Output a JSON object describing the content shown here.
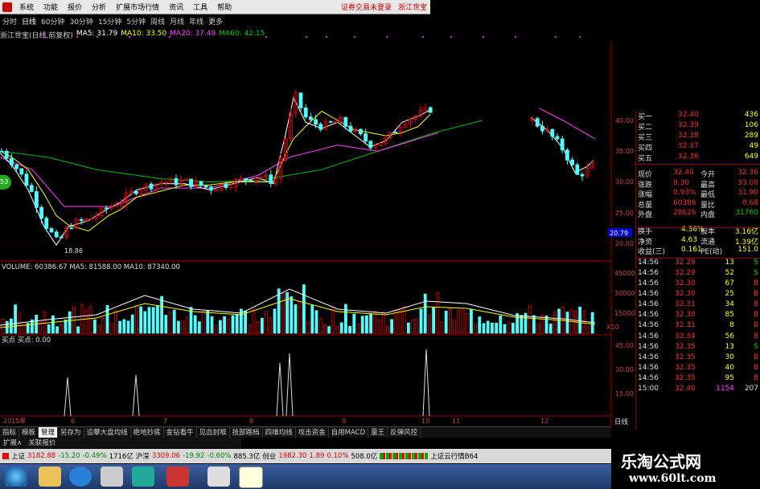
{
  "menu": {
    "items": [
      "系统",
      "功能",
      "报价",
      "分析",
      "扩展市场行情",
      "资讯",
      "工具",
      "帮助"
    ],
    "right": [
      "证券交易未登录",
      "浙江世宝"
    ]
  },
  "periods": [
    "分时",
    "日线",
    "60分钟",
    "30分钟",
    "15分钟",
    "5分钟",
    "周线",
    "月线",
    "年线",
    "更多"
  ],
  "info": {
    "name": "浙江世宝(日线,前复权)",
    "ma5": "MA5: 31.79",
    "ma10": "MA10: 33.50",
    "ma20": "MA20: 37.49",
    "ma60": "MA60: 42.15"
  },
  "price_axis": [
    "40.00",
    "35.00",
    "30.00",
    "25.00",
    "20.00"
  ],
  "low_label": "18.86",
  "last_price_tag": "20.79",
  "left_badge": "53",
  "volume": {
    "header": "VOLUME: 60386.67  MA5: 81588.00  MA10: 87340.00",
    "axis": [
      "45000",
      "30000",
      "15000",
      "X10"
    ]
  },
  "signal": {
    "header": "买点  买点: 0.00",
    "axis": [
      "45.00",
      "30.00",
      "15.00"
    ]
  },
  "date_axis": {
    "year": "2015年",
    "ticks": [
      "6",
      "7",
      "8",
      "9",
      "10",
      "11",
      "12"
    ],
    "right": "日线"
  },
  "quote": {
    "buy_rows": [
      {
        "label": "买一",
        "price": "32.40",
        "vol": "436"
      },
      {
        "label": "买二",
        "price": "32.39",
        "vol": "106"
      },
      {
        "label": "买三",
        "price": "32.38",
        "vol": "289"
      },
      {
        "label": "买四",
        "price": "32.37",
        "vol": "49"
      },
      {
        "label": "买五",
        "price": "32.36",
        "vol": "649"
      }
    ],
    "stats": [
      {
        "l1": "现价",
        "v1": "32.40",
        "l2": "今开",
        "v2": "32.36"
      },
      {
        "l1": "涨跌",
        "v1": "0.30",
        "l2": "最高",
        "v2": "33.00"
      },
      {
        "l1": "涨幅",
        "v1": "0.93%",
        "l2": "最低",
        "v2": "31.90"
      },
      {
        "l1": "总量",
        "v1": "60386",
        "l2": "量比",
        "v2": "0.68"
      },
      {
        "l1": "外盘",
        "v1": "28626",
        "l2": "内盘",
        "v2": "31760"
      }
    ],
    "stats2": [
      {
        "l1": "换手",
        "v1": "4.36%",
        "l2": "股本",
        "v2": "3.16亿"
      },
      {
        "l1": "净资",
        "v1": "4.63",
        "l2": "流通",
        "v2": "1.39亿"
      },
      {
        "l1": "收益(三)",
        "v1": "0.161",
        "l2": "PE(动)",
        "v2": "151.0"
      }
    ],
    "ticks": [
      {
        "time": "14:56",
        "price": "32.29",
        "vol": "13",
        "bs": "S"
      },
      {
        "time": "14:56",
        "price": "32.29",
        "vol": "52",
        "bs": "S"
      },
      {
        "time": "14:56",
        "price": "32.30",
        "vol": "67",
        "bs": "B"
      },
      {
        "time": "14:56",
        "price": "32.30",
        "vol": "25",
        "bs": "B"
      },
      {
        "time": "14:56",
        "price": "32.31",
        "vol": "34",
        "bs": "B"
      },
      {
        "time": "14:56",
        "price": "32.30",
        "vol": "85",
        "bs": "B"
      },
      {
        "time": "14:56",
        "price": "32.31",
        "vol": "8",
        "bs": "B"
      },
      {
        "time": "14:56",
        "price": "32.34",
        "vol": "56",
        "bs": "B"
      },
      {
        "time": "14:56",
        "price": "32.35",
        "vol": "13",
        "bs": "S"
      },
      {
        "time": "14:56",
        "price": "32.35",
        "vol": "30",
        "bs": "B"
      },
      {
        "time": "14:56",
        "price": "32.35",
        "vol": "40",
        "bs": "B"
      },
      {
        "time": "14:56",
        "price": "32.35",
        "vol": "95",
        "bs": "B"
      },
      {
        "time": "15:00",
        "price": "32.40",
        "vol": "1154",
        "bs": "207"
      }
    ]
  },
  "tabs": [
    "指标",
    "模板",
    "管理",
    "另存为",
    "追攀大盘均线",
    "绝地抄底",
    "金钻看牛",
    "见血封喉",
    "技部跳档",
    "四维均线",
    "攻击资金",
    "自用MACD",
    "量王",
    "反弹风控"
  ],
  "tabs_active": "管理",
  "tabs2": [
    "扩展∧",
    "关联报价"
  ],
  "status": {
    "sh_name": "上证",
    "sh_val": "3182.88",
    "sh_chg": "-15.20",
    "sh_pct": "-0.49%",
    "sh_amt": "1716亿",
    "hs_name": "沪深",
    "hs_val": "3309.06",
    "hs_chg": "-19.92",
    "hs_pct": "-0.60%",
    "hs_amt": "885.3亿",
    "cy_name": "创业",
    "cy_val": "1982.30",
    "cy_chg": "1.89",
    "cy_pct": "0.10%",
    "cy_amt": "508.0亿",
    "cloud": "上证云行情B64"
  },
  "watermark": {
    "line1": "乐淘公式网",
    "line2": "www.60lt.com"
  },
  "colors": {
    "up": "#e00000",
    "down": "#54ffff",
    "ma5": "#ffffff",
    "ma10": "#ffff00",
    "ma20": "#ff40ff",
    "ma60": "#00c000"
  }
}
